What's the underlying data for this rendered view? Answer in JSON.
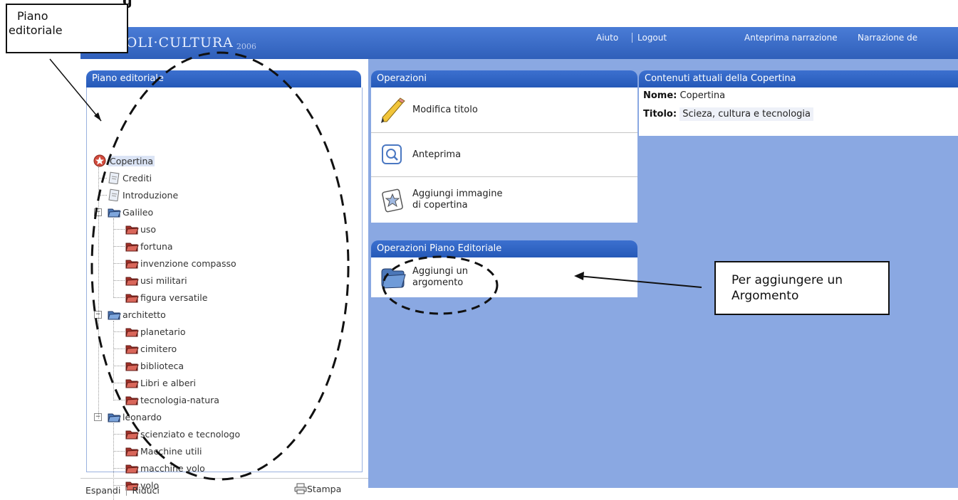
{
  "top_fragment": "g",
  "topbar": {
    "logo_text": "POLI·CULTURA",
    "logo_year": "2006",
    "help": "Aiuto",
    "logout": "Logout",
    "preview_narration": "Anteprima narrazione",
    "narration": "Narrazione de"
  },
  "sidebar": {
    "title": "Piano editoriale",
    "tree": [
      {
        "label": "Copertina",
        "type": "cover",
        "selected": true
      },
      {
        "label": "Crediti",
        "type": "page"
      },
      {
        "label": "Introduzione",
        "type": "page"
      },
      {
        "label": "Galileo",
        "type": "folder-blue"
      },
      {
        "label": "uso",
        "type": "folder-red"
      },
      {
        "label": "fortuna",
        "type": "folder-red"
      },
      {
        "label": "invenzione compasso",
        "type": "folder-red"
      },
      {
        "label": "usi militari",
        "type": "folder-red"
      },
      {
        "label": "figura versatile",
        "type": "folder-red"
      },
      {
        "label": "architetto",
        "type": "folder-blue"
      },
      {
        "label": "planetario",
        "type": "folder-red"
      },
      {
        "label": "cimitero",
        "type": "folder-red"
      },
      {
        "label": "biblioteca",
        "type": "folder-red"
      },
      {
        "label": "Libri e alberi",
        "type": "folder-red"
      },
      {
        "label": "tecnologia-natura",
        "type": "folder-red"
      },
      {
        "label": "leonardo",
        "type": "folder-blue"
      },
      {
        "label": "scienziato e tecnologo",
        "type": "folder-red"
      },
      {
        "label": "Macchine utili",
        "type": "folder-red"
      },
      {
        "label": "macchine volo",
        "type": "folder-red"
      },
      {
        "label": "volo",
        "type": "folder-red"
      }
    ],
    "expand": "Espandi",
    "separator": "|",
    "collapse": "Riduci",
    "print": "Stampa"
  },
  "operations": {
    "title": "Operazioni",
    "items": [
      {
        "label": "Modifica titolo",
        "icon": "pencil-icon"
      },
      {
        "label": "Anteprima",
        "icon": "magnifier-icon"
      },
      {
        "label_line1": "Aggiungi immagine",
        "label_line2": "di copertina",
        "icon": "image-star-icon"
      }
    ]
  },
  "editorial_ops": {
    "title": "Operazioni Piano Editoriale",
    "item_line1": "Aggiungi un",
    "item_line2": "argomento"
  },
  "current_content": {
    "title": "Contenuti attuali della Copertina",
    "name_label": "Nome:",
    "name_value": "Copertina",
    "title_label": "Titolo:",
    "title_value": "Scieza, cultura e tecnologia"
  },
  "callouts": {
    "piano_line1": "Piano",
    "piano_line2": "editoriale",
    "argomento_line1": "Per aggiungere un",
    "argomento_line2": "Argomento"
  },
  "colors": {
    "topbar": "#3f6fc9",
    "background": "#8aa8e2",
    "panel_header": "#2f62c0",
    "folder_red": "#c4443a",
    "folder_blue": "#4d7fc4"
  }
}
